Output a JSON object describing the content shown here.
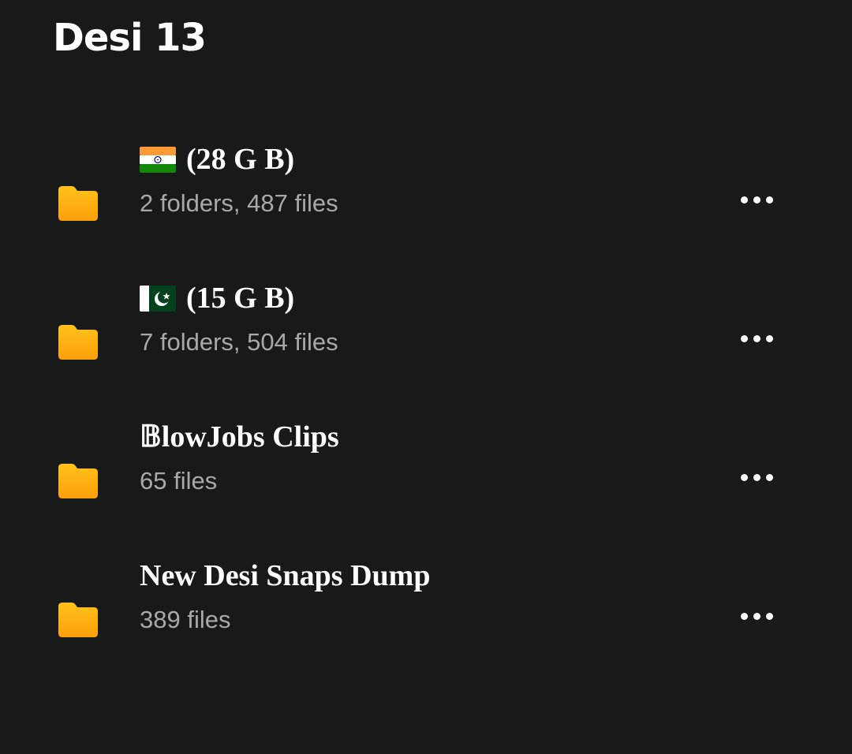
{
  "header": {
    "title": "Desi 13"
  },
  "folders": [
    {
      "flag": "india-flag",
      "title": "(28 G B)",
      "subtitle": "2 folders, 487 files"
    },
    {
      "flag": "pakistan-flag",
      "title": "(15 G B)",
      "subtitle": "7 folders, 504 files"
    },
    {
      "title": "𝔹lowJobs Clips",
      "subtitle": "65 files"
    },
    {
      "title": "New Desi Snaps Dump",
      "subtitle": "389 files"
    }
  ],
  "icons": {
    "folder": "folder-icon",
    "more": "more-options-icon"
  },
  "colors": {
    "background": "#181919",
    "folder_top": "#FFC21A",
    "folder_bottom": "#FF9F0A",
    "title": "#FFFFFF",
    "subtitle": "#A9A9A9"
  }
}
